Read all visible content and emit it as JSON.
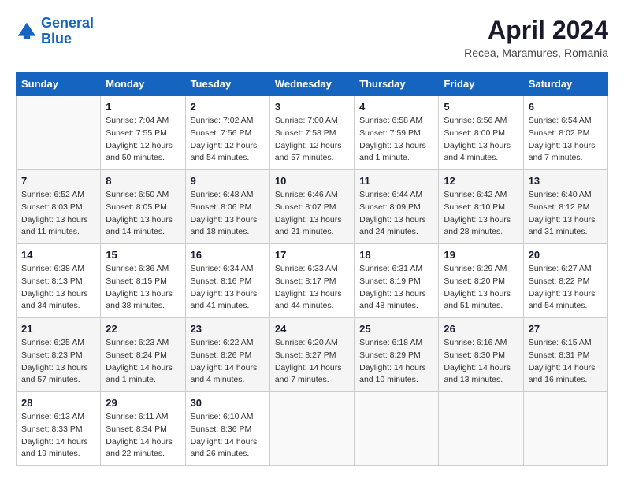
{
  "header": {
    "logo_line1": "General",
    "logo_line2": "Blue",
    "title": "April 2024",
    "subtitle": "Recea, Maramures, Romania"
  },
  "calendar": {
    "days_of_week": [
      "Sunday",
      "Monday",
      "Tuesday",
      "Wednesday",
      "Thursday",
      "Friday",
      "Saturday"
    ],
    "weeks": [
      [
        {
          "num": "",
          "info": ""
        },
        {
          "num": "1",
          "info": "Sunrise: 7:04 AM\nSunset: 7:55 PM\nDaylight: 12 hours\nand 50 minutes."
        },
        {
          "num": "2",
          "info": "Sunrise: 7:02 AM\nSunset: 7:56 PM\nDaylight: 12 hours\nand 54 minutes."
        },
        {
          "num": "3",
          "info": "Sunrise: 7:00 AM\nSunset: 7:58 PM\nDaylight: 12 hours\nand 57 minutes."
        },
        {
          "num": "4",
          "info": "Sunrise: 6:58 AM\nSunset: 7:59 PM\nDaylight: 13 hours\nand 1 minute."
        },
        {
          "num": "5",
          "info": "Sunrise: 6:56 AM\nSunset: 8:00 PM\nDaylight: 13 hours\nand 4 minutes."
        },
        {
          "num": "6",
          "info": "Sunrise: 6:54 AM\nSunset: 8:02 PM\nDaylight: 13 hours\nand 7 minutes."
        }
      ],
      [
        {
          "num": "7",
          "info": "Sunrise: 6:52 AM\nSunset: 8:03 PM\nDaylight: 13 hours\nand 11 minutes."
        },
        {
          "num": "8",
          "info": "Sunrise: 6:50 AM\nSunset: 8:05 PM\nDaylight: 13 hours\nand 14 minutes."
        },
        {
          "num": "9",
          "info": "Sunrise: 6:48 AM\nSunset: 8:06 PM\nDaylight: 13 hours\nand 18 minutes."
        },
        {
          "num": "10",
          "info": "Sunrise: 6:46 AM\nSunset: 8:07 PM\nDaylight: 13 hours\nand 21 minutes."
        },
        {
          "num": "11",
          "info": "Sunrise: 6:44 AM\nSunset: 8:09 PM\nDaylight: 13 hours\nand 24 minutes."
        },
        {
          "num": "12",
          "info": "Sunrise: 6:42 AM\nSunset: 8:10 PM\nDaylight: 13 hours\nand 28 minutes."
        },
        {
          "num": "13",
          "info": "Sunrise: 6:40 AM\nSunset: 8:12 PM\nDaylight: 13 hours\nand 31 minutes."
        }
      ],
      [
        {
          "num": "14",
          "info": "Sunrise: 6:38 AM\nSunset: 8:13 PM\nDaylight: 13 hours\nand 34 minutes."
        },
        {
          "num": "15",
          "info": "Sunrise: 6:36 AM\nSunset: 8:15 PM\nDaylight: 13 hours\nand 38 minutes."
        },
        {
          "num": "16",
          "info": "Sunrise: 6:34 AM\nSunset: 8:16 PM\nDaylight: 13 hours\nand 41 minutes."
        },
        {
          "num": "17",
          "info": "Sunrise: 6:33 AM\nSunset: 8:17 PM\nDaylight: 13 hours\nand 44 minutes."
        },
        {
          "num": "18",
          "info": "Sunrise: 6:31 AM\nSunset: 8:19 PM\nDaylight: 13 hours\nand 48 minutes."
        },
        {
          "num": "19",
          "info": "Sunrise: 6:29 AM\nSunset: 8:20 PM\nDaylight: 13 hours\nand 51 minutes."
        },
        {
          "num": "20",
          "info": "Sunrise: 6:27 AM\nSunset: 8:22 PM\nDaylight: 13 hours\nand 54 minutes."
        }
      ],
      [
        {
          "num": "21",
          "info": "Sunrise: 6:25 AM\nSunset: 8:23 PM\nDaylight: 13 hours\nand 57 minutes."
        },
        {
          "num": "22",
          "info": "Sunrise: 6:23 AM\nSunset: 8:24 PM\nDaylight: 14 hours\nand 1 minute."
        },
        {
          "num": "23",
          "info": "Sunrise: 6:22 AM\nSunset: 8:26 PM\nDaylight: 14 hours\nand 4 minutes."
        },
        {
          "num": "24",
          "info": "Sunrise: 6:20 AM\nSunset: 8:27 PM\nDaylight: 14 hours\nand 7 minutes."
        },
        {
          "num": "25",
          "info": "Sunrise: 6:18 AM\nSunset: 8:29 PM\nDaylight: 14 hours\nand 10 minutes."
        },
        {
          "num": "26",
          "info": "Sunrise: 6:16 AM\nSunset: 8:30 PM\nDaylight: 14 hours\nand 13 minutes."
        },
        {
          "num": "27",
          "info": "Sunrise: 6:15 AM\nSunset: 8:31 PM\nDaylight: 14 hours\nand 16 minutes."
        }
      ],
      [
        {
          "num": "28",
          "info": "Sunrise: 6:13 AM\nSunset: 8:33 PM\nDaylight: 14 hours\nand 19 minutes."
        },
        {
          "num": "29",
          "info": "Sunrise: 6:11 AM\nSunset: 8:34 PM\nDaylight: 14 hours\nand 22 minutes."
        },
        {
          "num": "30",
          "info": "Sunrise: 6:10 AM\nSunset: 8:36 PM\nDaylight: 14 hours\nand 26 minutes."
        },
        {
          "num": "",
          "info": ""
        },
        {
          "num": "",
          "info": ""
        },
        {
          "num": "",
          "info": ""
        },
        {
          "num": "",
          "info": ""
        }
      ]
    ]
  }
}
